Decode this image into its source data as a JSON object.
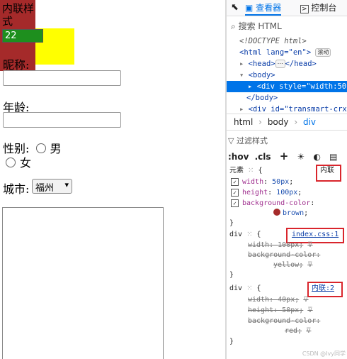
{
  "left": {
    "inline_style_text": "内联样式",
    "input_value": "22",
    "nickname_label": "昵称:",
    "age_label": "年龄:",
    "gender_label": "性别:",
    "gender_options": [
      "男",
      "女"
    ],
    "city_label": "城市:",
    "city_selected": "福州"
  },
  "devtools": {
    "tabs": {
      "inspector": "查看器",
      "console": "控制台"
    },
    "search_placeholder": "搜索 HTML",
    "tree": {
      "doctype": "<!DOCTYPE html>",
      "html_open": "<html lang=\"en\">",
      "scroll_badge": "滚动",
      "head": "<head>",
      "head_close": "</head>",
      "body_open": "<body>",
      "selected_div": "<div style=\"width:50p",
      "body_close": "</body>",
      "next_div": "<div id=\"transmart-crx-"
    },
    "breadcrumbs": [
      "html",
      "body",
      "div"
    ],
    "filter_placeholder": "过滤样式",
    "rules_toolbar": [
      ":hov",
      ".cls"
    ],
    "rules": [
      {
        "selector": "元素",
        "source": "内联",
        "props": [
          {
            "name": "width",
            "value": "50px",
            "overridden": false,
            "checked": true
          },
          {
            "name": "height",
            "value": "100px",
            "overridden": false,
            "checked": true
          },
          {
            "name": "background-color",
            "value": "brown",
            "overridden": false,
            "checked": true
          }
        ]
      },
      {
        "selector": "div",
        "source": "index.css:1",
        "props": [
          {
            "name": "width",
            "value": "100px",
            "overridden": true
          },
          {
            "name": "background-color",
            "value": "yellow",
            "overridden": true
          }
        ]
      },
      {
        "selector": "div",
        "source": "内联:2",
        "props": [
          {
            "name": "width",
            "value": "40px",
            "overridden": true
          },
          {
            "name": "height",
            "value": "50px",
            "overridden": true
          },
          {
            "name": "background-color",
            "value": "red",
            "overridden": true
          }
        ]
      }
    ],
    "watermark": "CSDN @Ivy同学"
  },
  "colors": {
    "brown": "#a52a2a",
    "yellow": "#ffff00",
    "selection": "#0074e8",
    "highlight_border": "#d9252c"
  }
}
